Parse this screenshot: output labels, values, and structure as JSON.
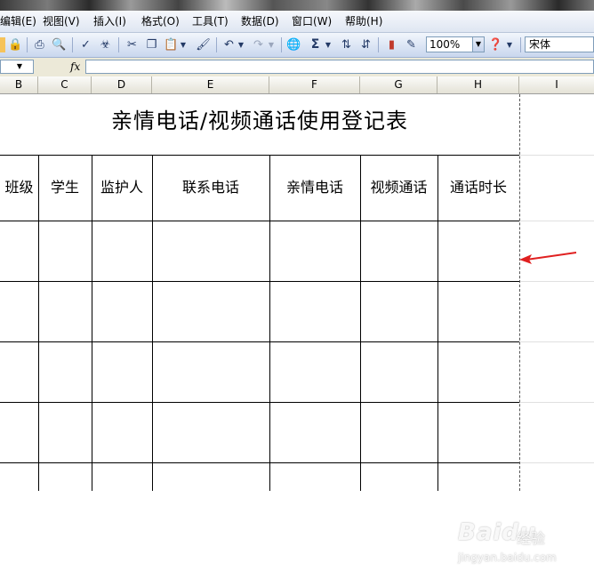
{
  "menubar": {
    "items": [
      {
        "label": "编辑(E)"
      },
      {
        "label": "视图(V)"
      },
      {
        "label": "插入(I)"
      },
      {
        "label": "格式(O)"
      },
      {
        "label": "工具(T)"
      },
      {
        "label": "数据(D)"
      },
      {
        "label": "窗口(W)"
      },
      {
        "label": "帮助(H)"
      }
    ]
  },
  "toolbar": {
    "zoom_value": "100%",
    "font_name": "宋体",
    "sigma_symbol": "Σ"
  },
  "formula_bar": {
    "fx_label": "fx"
  },
  "columns": [
    "B",
    "C",
    "D",
    "E",
    "F",
    "G",
    "H",
    "I"
  ],
  "sheet": {
    "title": "亲情电话/视频通话使用登记表",
    "headers": [
      "班级",
      "学生",
      "监护人",
      "联系电话",
      "亲情电话",
      "视频通话",
      "通话时长"
    ]
  },
  "annotation": {
    "arrow_color": "#e02020"
  },
  "watermark": {
    "brand": "Baidu",
    "sub": "经验",
    "url": "jingyan.baidu.com"
  }
}
